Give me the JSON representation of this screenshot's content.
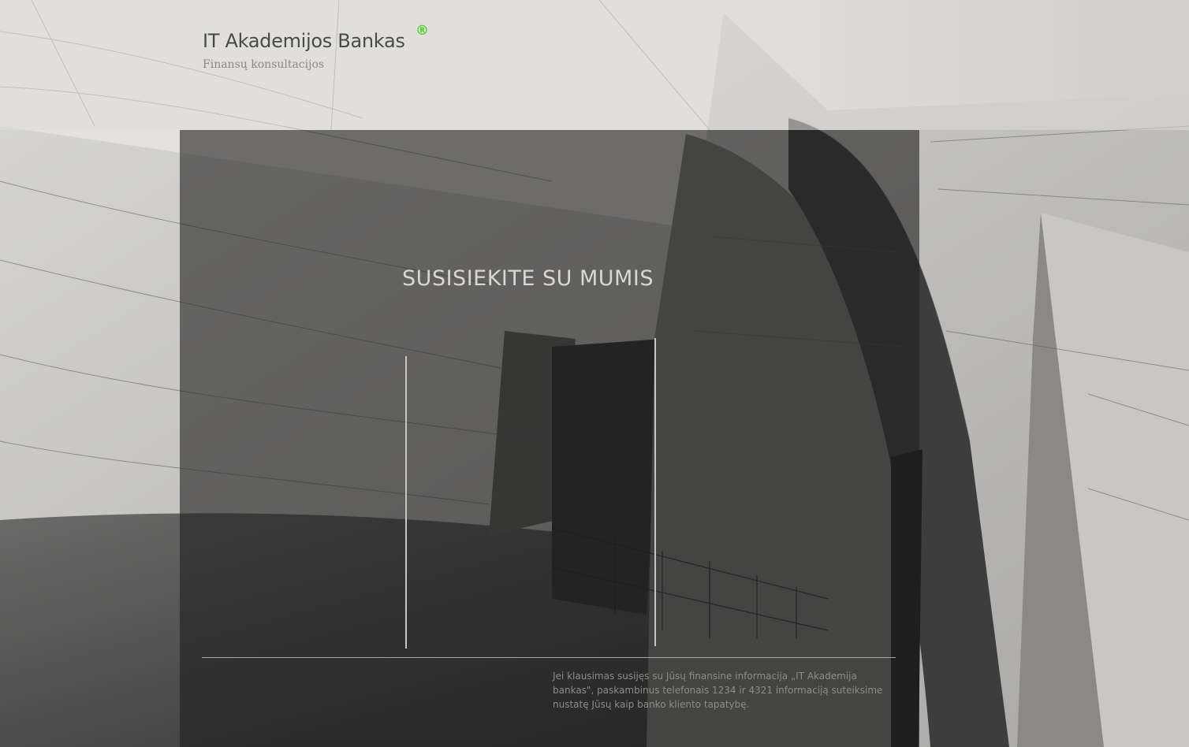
{
  "header": {
    "brand_name": "IT Akademijos Bankas",
    "registered_mark": "®",
    "tagline": "Finansų konsultacijos"
  },
  "main": {
    "title": "SUSISIEKITE SU MUMIS",
    "contact_text": "Jei klausimas susijęs su Jūsų finansine informacija „IT Akademija bankas\", paskambinus telefonais 1234 ir 4321 informaciją suteiksime nustatę Jūsų kaip banko kliento tapatybę."
  },
  "colors": {
    "accent": "#4fcf2d",
    "header_band": "#dedcd6",
    "panel_overlay": "#1e1e1e",
    "title_text": "#dad7d2",
    "body_text": "#8f8c88"
  },
  "icons": {
    "registered": "registered-trademark-icon"
  }
}
